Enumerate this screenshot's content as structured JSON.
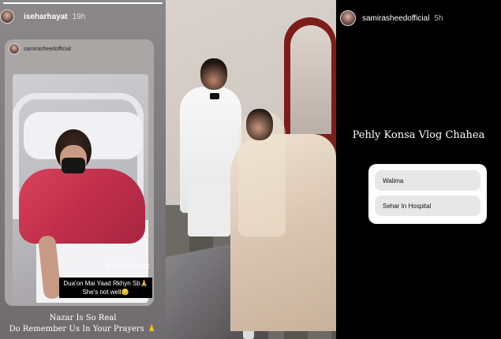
{
  "left_story": {
    "username": "iseharhayat",
    "time": "19h",
    "progress": 1.0,
    "reshared_account": "samirasheedofficial",
    "handle_overlay": "@iseharhayat",
    "caption_line1": "Dua'on Mai Yaad Rkhyn Sb🙏",
    "caption_line2": "She's not well😔",
    "footer_line1": "Nazar Is So Real",
    "footer_line2": "Do Remember Us In Your Prayers 🙏"
  },
  "right_story": {
    "username": "samirasheedofficial",
    "time": "5h",
    "question": "Pehly Konsa Vlog Chahea",
    "options": [
      "Walima",
      "Sehar In Hospital"
    ]
  },
  "colors": {
    "story_bg_dark": "#000000",
    "story_bg_gray": "#7a7878",
    "poll_bg": "#ffffff",
    "poll_option_bg": "#e7e7e7"
  }
}
